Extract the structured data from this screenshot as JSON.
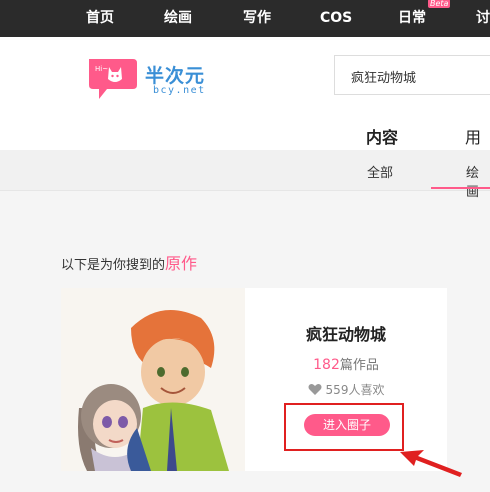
{
  "nav": {
    "items": [
      "首页",
      "绘画",
      "写作",
      "COS",
      "日常",
      "讨"
    ],
    "beta_badge": "Beta"
  },
  "logo": {
    "name_cn": "半次元",
    "domain": "bcy.net",
    "bubble_text": "Hi~",
    "brand_color": "#3a8fd6",
    "accent_color": "#ff5a8a"
  },
  "search": {
    "value": "疯狂动物城"
  },
  "main_tabs": [
    "内容",
    "用户"
  ],
  "sub_tabs": [
    "全部",
    "绘画"
  ],
  "results": {
    "prefix": "以下是为你搜到的",
    "keyword": "原作"
  },
  "card": {
    "title": "疯狂动物城",
    "works_count": "182",
    "works_suffix": "篇作品",
    "likes_text": "559人喜欢",
    "join_button": "进入圈子"
  }
}
